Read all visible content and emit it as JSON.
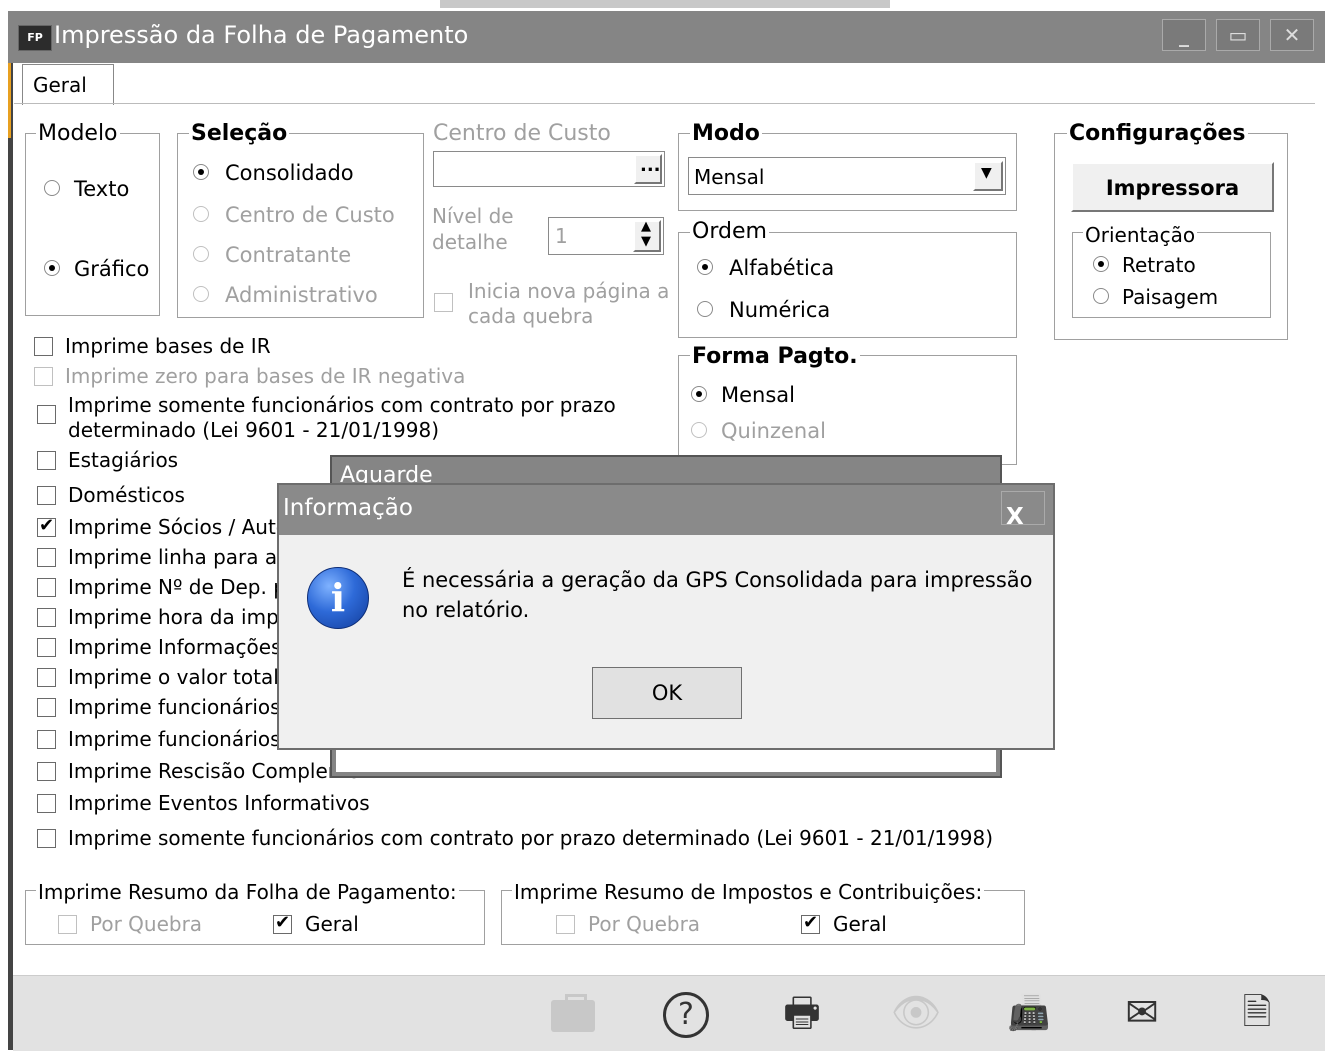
{
  "window": {
    "app_icon_text": "FP",
    "title": "Impressão da Folha de Pagamento"
  },
  "tabs": [
    {
      "label": "Geral"
    }
  ],
  "modelo": {
    "legend": "Modelo",
    "options": [
      "Texto",
      "Gráfico"
    ],
    "selected": "Gráfico"
  },
  "selecao": {
    "legend": "Seleção",
    "options": [
      "Consolidado",
      "Centro de Custo",
      "Contratante",
      "Administrativo"
    ],
    "selected": "Consolidado"
  },
  "centro_custo": {
    "label": "Centro de Custo",
    "browse_label": "...",
    "nivel_label_1": "Nível de",
    "nivel_label_2": "detalhe",
    "nivel_value": "1",
    "nova_pagina_1": "Inicia nova página a",
    "nova_pagina_2": "cada quebra"
  },
  "modo": {
    "legend": "Modo",
    "value": "Mensal"
  },
  "ordem": {
    "legend": "Ordem",
    "options": [
      "Alfabética",
      "Numérica"
    ],
    "selected": "Alfabética"
  },
  "forma_pagto": {
    "legend": "Forma Pagto.",
    "options": [
      "Mensal",
      "Quinzenal"
    ],
    "selected": "Mensal"
  },
  "configuracoes": {
    "legend": "Configurações",
    "printer_button": "Impressora",
    "orientacao_legend": "Orientação",
    "orientacao_options": [
      "Retrato",
      "Paisagem"
    ],
    "orientacao_selected": "Retrato"
  },
  "checkboxes": {
    "bases_ir": "Imprime bases de IR",
    "zero_bases": "Imprime zero para bases de IR negativa",
    "contrato_prazo_1": "Imprime somente funcionários com contrato por prazo",
    "contrato_prazo_2": "determinado (Lei 9601 - 21/01/1998)",
    "estagiarios": "Estagiários",
    "domesticos": "Domésticos",
    "socios": "Imprime Sócios / Autô",
    "linha_ass": "Imprime linha para ass",
    "num_dep": "Imprime Nº de Dep. p",
    "hora_impr": "Imprime hora da impre",
    "informacoes": "Imprime Informações",
    "valor_total": "Imprime o valor total",
    "funcionarios_1": "Imprime funcionários",
    "funcionarios_2": "Imprime funcionários",
    "rescisao": "Imprime Rescisão Compleme",
    "eventos": "Imprime Eventos Informativos",
    "contrato_prazo_full": "Imprime somente funcionários com contrato por prazo determinado (Lei 9601 - 21/01/1998)"
  },
  "resumo_folha": {
    "legend": "Imprime Resumo da Folha de Pagamento:",
    "por_quebra": "Por Quebra",
    "geral": "Geral"
  },
  "resumo_impostos": {
    "legend": "Imprime Resumo de Impostos e Contribuições:",
    "por_quebra": "Por Quebra",
    "geral": "Geral"
  },
  "toolbar": {
    "icons": [
      "briefcase-icon",
      "help-icon",
      "print-icon",
      "preview-icon",
      "fax-icon",
      "email-icon",
      "close-document-icon"
    ]
  },
  "wait_dialog": {
    "title": "Aguarde"
  },
  "info_dialog": {
    "title": "Informação",
    "close_label": "X",
    "message": "É necessária a geração da GPS Consolidada para impressão no relatório.",
    "ok_label": "OK"
  }
}
